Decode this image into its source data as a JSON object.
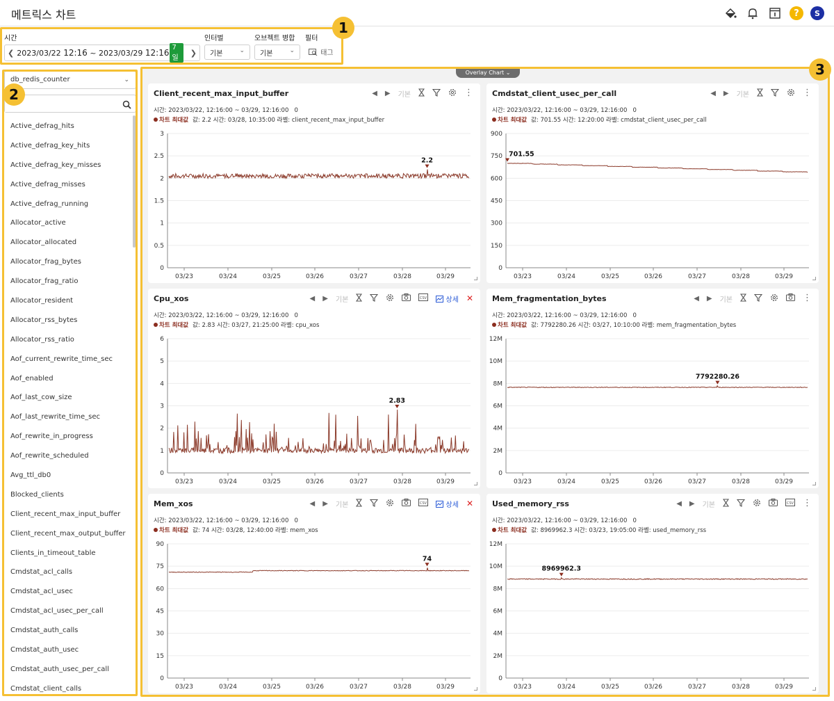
{
  "app": {
    "title": "메트릭스 차트"
  },
  "header_icons": [
    "paint-bucket-icon",
    "bell-icon",
    "info-panel-icon",
    "help-icon",
    "avatar"
  ],
  "help_glyph": "?",
  "avatar_initial": "S",
  "filters": {
    "time_label": "시간",
    "time_start_date": "2023/03/22",
    "time_start_clock": "12:16",
    "time_sep": "~",
    "time_end_date": "2023/03/29",
    "time_end_clock": "12:16",
    "days_badge": "7일",
    "interval_label": "인터벌",
    "interval_value": "기본",
    "merge_label": "오브젝트 병합",
    "merge_value": "기본",
    "filter_label": "필터",
    "tag_label": "태그"
  },
  "badges": [
    "1",
    "2",
    "3"
  ],
  "sidebar": {
    "db_select": "db_redis_counter",
    "search_placeholder": "",
    "metrics": [
      "Active_defrag_hits",
      "Active_defrag_key_hits",
      "Active_defrag_key_misses",
      "Active_defrag_misses",
      "Active_defrag_running",
      "Allocator_active",
      "Allocator_allocated",
      "Allocator_frag_bytes",
      "Allocator_frag_ratio",
      "Allocator_resident",
      "Allocator_rss_bytes",
      "Allocator_rss_ratio",
      "Aof_current_rewrite_time_sec",
      "Aof_enabled",
      "Aof_last_cow_size",
      "Aof_last_rewrite_time_sec",
      "Aof_rewrite_in_progress",
      "Aof_rewrite_scheduled",
      "Avg_ttl_db0",
      "Blocked_clients",
      "Client_recent_max_input_buffer",
      "Client_recent_max_output_buffer",
      "Clients_in_timeout_table",
      "Cmdstat_acl_calls",
      "Cmdstat_acl_usec",
      "Cmdstat_acl_usec_per_call",
      "Cmdstat_auth_calls",
      "Cmdstat_auth_usec",
      "Cmdstat_auth_usec_per_call",
      "Cmdstat_client_calls"
    ]
  },
  "overlay_chart_label": "Overlay Chart ⌄",
  "toolbar_labels": {
    "basic": "기본",
    "detail": "상세",
    "csv": "CSV"
  },
  "panels": [
    {
      "title": "Client_recent_max_input_buffer",
      "time_info": "시간: 2023/03/22, 12:16:00 ~ 03/29, 12:16:00",
      "count": "0",
      "max_label": "차트 최대값",
      "max_info": "값: 2.2   시간: 03/28, 10:35:00   라벨: client_recent_max_input_buffer",
      "tools": "basic",
      "color": "#8b3a2a",
      "chart_data": {
        "type": "line",
        "y_ticks": [
          "3",
          "2.5",
          "2",
          "1.5",
          "1",
          "0.5",
          "0"
        ],
        "ylim": [
          0,
          3
        ],
        "x_ticks": [
          "03/23",
          "03/24",
          "03/25",
          "03/26",
          "03/27",
          "03/28",
          "03/29"
        ],
        "baseline": 2.05,
        "noise": 0.05,
        "spikes": 0.03,
        "trend": 0,
        "steps": 0,
        "max": {
          "value": 2.2,
          "label": "2.2",
          "x_frac": 0.86
        }
      }
    },
    {
      "title": "Cmdstat_client_usec_per_call",
      "time_info": "시간: 2023/03/22, 12:16:00 ~ 03/29, 12:16:00",
      "count": "0",
      "max_label": "차트 최대값",
      "max_info": "값: 701.55   시간: 12:20:00   라벨: cmdstat_client_usec_per_call",
      "tools": "basic",
      "color": "#8b3a2a",
      "chart_data": {
        "type": "line",
        "y_ticks": [
          "900",
          "750",
          "600",
          "450",
          "300",
          "150",
          "0"
        ],
        "ylim": [
          0,
          900
        ],
        "x_ticks": [
          "03/23",
          "03/24",
          "03/25",
          "03/26",
          "03/27",
          "03/28",
          "03/29"
        ],
        "baseline": 700,
        "noise": 1,
        "spikes": 0,
        "trend": -62,
        "steps": 1,
        "max": {
          "value": 701.55,
          "label": "701.55",
          "x_frac": 0.0
        }
      }
    },
    {
      "title": "Cpu_xos",
      "time_info": "시간: 2023/03/22, 12:16:00 ~ 03/29, 12:16:00",
      "count": "0",
      "max_label": "차트 최대값",
      "max_info": "값: 2.83   시간: 03/27, 21:25:00   라벨: cpu_xos",
      "tools": "full",
      "color": "#8b3a2a",
      "chart_data": {
        "type": "line",
        "y_ticks": [
          "6",
          "5",
          "4",
          "3",
          "2",
          "1",
          "0"
        ],
        "ylim": [
          0,
          6
        ],
        "x_ticks": [
          "03/23",
          "03/24",
          "03/25",
          "03/26",
          "03/27",
          "03/28",
          "03/29"
        ],
        "baseline": 1.0,
        "noise": 0.12,
        "spikes": 1.3,
        "trend": 0,
        "steps": 0,
        "max": {
          "value": 2.83,
          "label": "2.83",
          "x_frac": 0.76
        }
      }
    },
    {
      "title": "Mem_fragmentation_bytes",
      "time_info": "시간: 2023/03/22, 12:16:00 ~ 03/29, 12:16:00",
      "count": "0",
      "max_label": "차트 최대값",
      "max_info": "값: 7792280.26   시간: 03/27, 10:10:00   라벨: mem_fragmentation_bytes",
      "tools": "camera",
      "color": "#8b3a2a",
      "chart_data": {
        "type": "line",
        "y_ticks": [
          "12M",
          "10M",
          "8M",
          "6M",
          "4M",
          "2M",
          "0"
        ],
        "ylim": [
          0,
          12000000
        ],
        "x_ticks": [
          "03/23",
          "03/24",
          "03/25",
          "03/26",
          "03/27",
          "03/28",
          "03/29"
        ],
        "baseline": 7650000,
        "noise": 30000,
        "spikes": 0,
        "trend": 0,
        "steps": 0,
        "max": {
          "value": 7792280.26,
          "label": "7792280.26",
          "x_frac": 0.7
        }
      }
    },
    {
      "title": "Mem_xos",
      "time_info": "시간: 2023/03/22, 12:16:00 ~ 03/29, 12:16:00",
      "count": "0",
      "max_label": "차트 최대값",
      "max_info": "값: 74   시간: 03/28, 12:40:00   라벨: mem_xos",
      "tools": "full",
      "color": "#8b3a2a",
      "chart_data": {
        "type": "line",
        "y_ticks": [
          "90",
          "75",
          "60",
          "45",
          "30",
          "15",
          "0"
        ],
        "ylim": [
          0,
          90
        ],
        "x_ticks": [
          "03/23",
          "03/24",
          "03/25",
          "03/26",
          "03/27",
          "03/28",
          "03/29"
        ],
        "baseline": 71,
        "noise": 0.2,
        "spikes": 0,
        "trend": 0,
        "steps": 2,
        "max": {
          "value": 74,
          "label": "74",
          "x_frac": 0.86
        }
      }
    },
    {
      "title": "Used_memory_rss",
      "time_info": "시간: 2023/03/22, 12:16:00 ~ 03/29, 12:16:00",
      "count": "0",
      "max_label": "차트 최대값",
      "max_info": "값: 8969962.3   시간: 03/23, 19:05:00   라벨: used_memory_rss",
      "tools": "full-noclose",
      "color": "#8b3a2a",
      "chart_data": {
        "type": "line",
        "y_ticks": [
          "12M",
          "10M",
          "8M",
          "6M",
          "4M",
          "2M",
          "0"
        ],
        "ylim": [
          0,
          12000000
        ],
        "x_ticks": [
          "03/23",
          "03/24",
          "03/25",
          "03/26",
          "03/27",
          "03/28",
          "03/29"
        ],
        "baseline": 8850000,
        "noise": 40000,
        "spikes": 0,
        "trend": 0,
        "steps": 0,
        "max": {
          "value": 8969962.3,
          "label": "8969962.3",
          "x_frac": 0.18
        }
      }
    }
  ]
}
